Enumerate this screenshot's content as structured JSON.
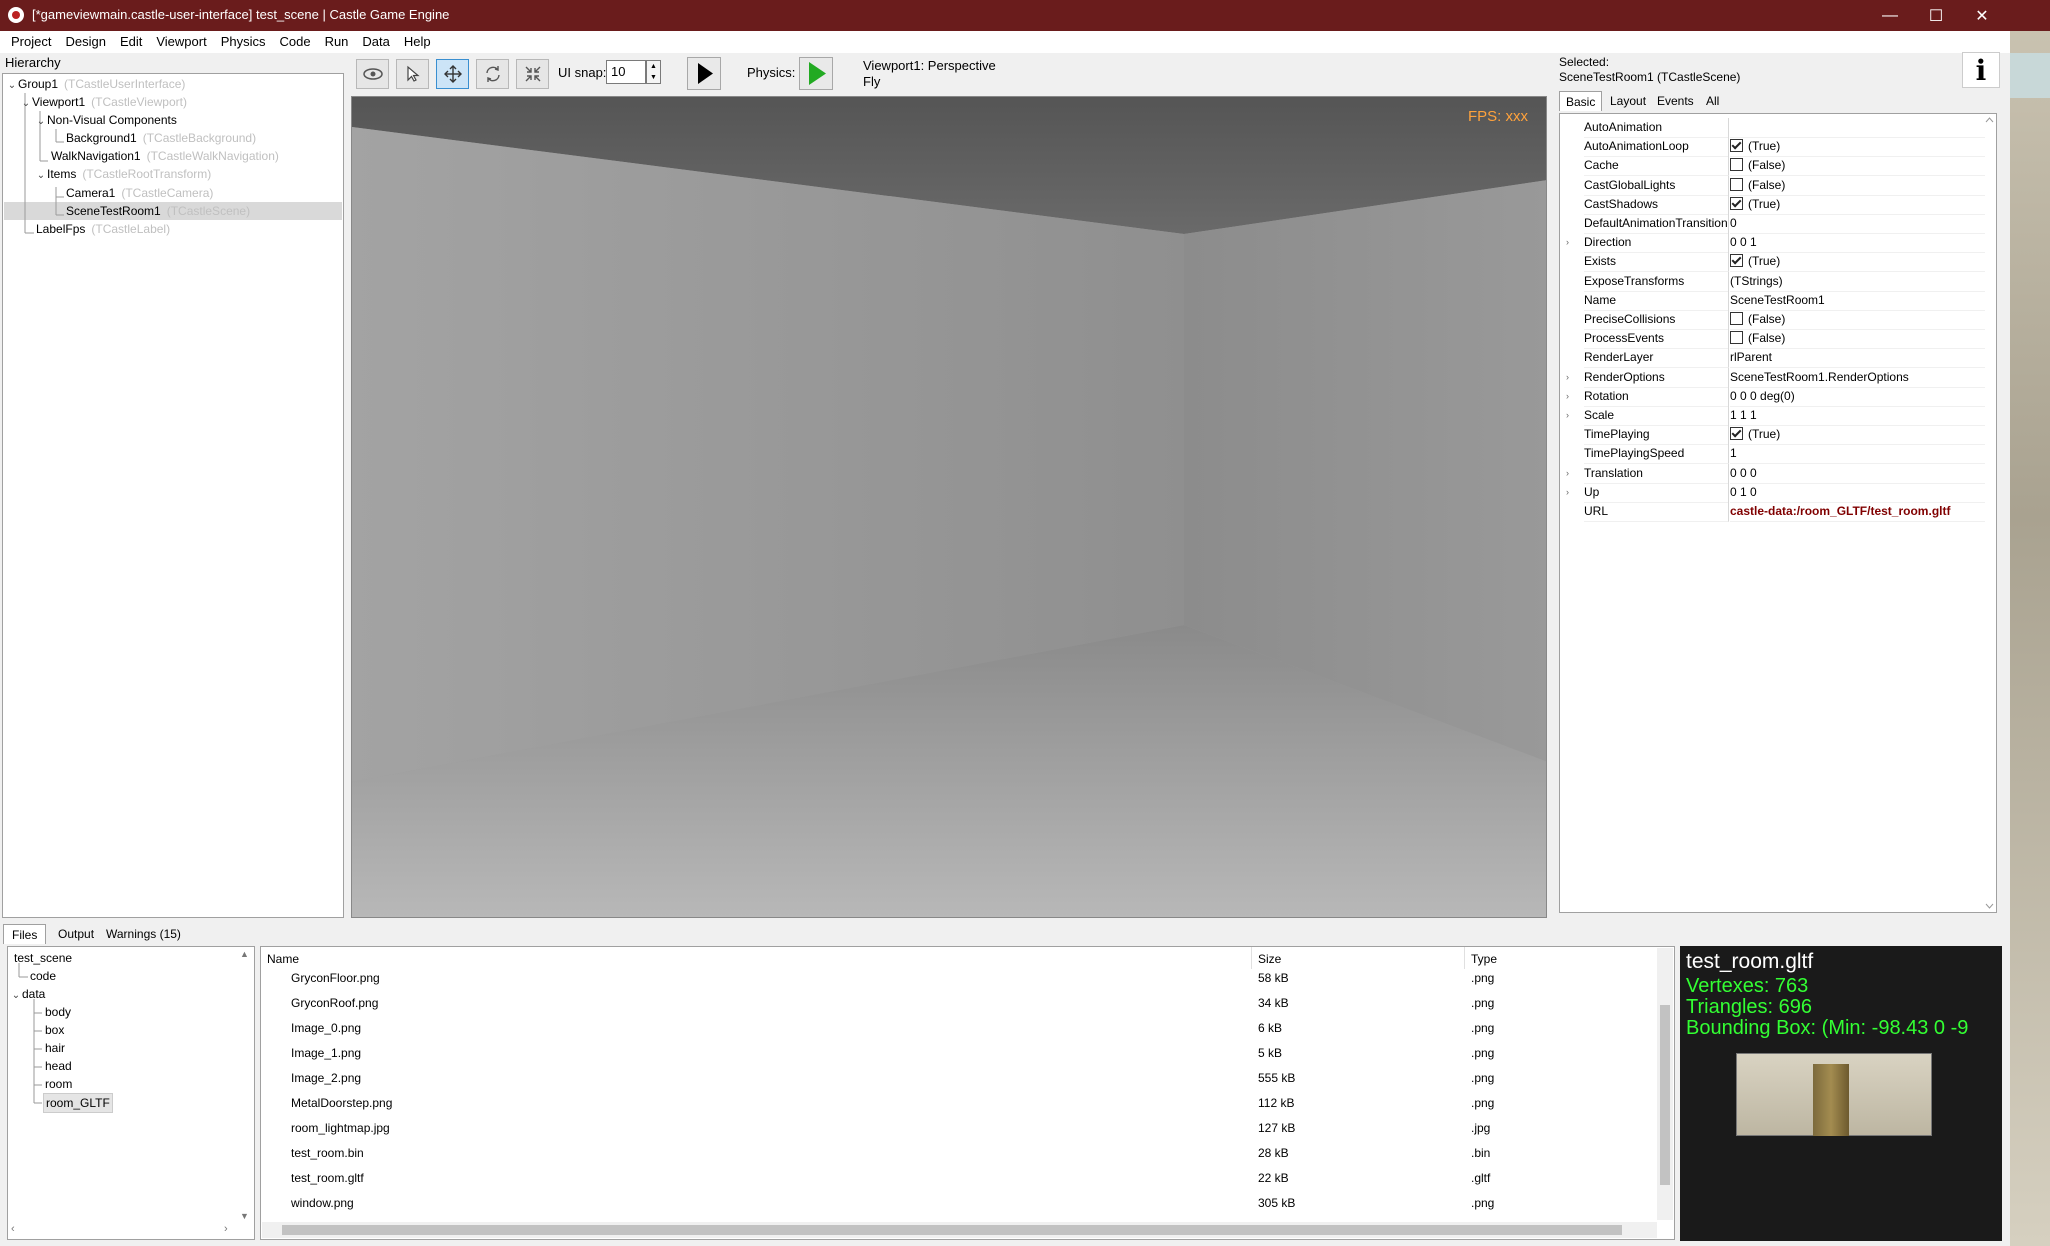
{
  "window": {
    "title": "[*gameviewmain.castle-user-interface] test_scene | Castle Game Engine",
    "controls": {
      "minimize": "—",
      "maximize": "☐",
      "close": "✕"
    }
  },
  "menu": [
    "Project",
    "Design",
    "Edit",
    "Viewport",
    "Physics",
    "Code",
    "Run",
    "Data",
    "Help"
  ],
  "hierarchy": {
    "label": "Hierarchy",
    "items": [
      {
        "name": "Group1",
        "class": "(TCastleUserInterface)"
      },
      {
        "name": "Viewport1",
        "class": "(TCastleViewport)"
      },
      {
        "name": "Non-Visual Components",
        "class": ""
      },
      {
        "name": "Background1",
        "class": "(TCastleBackground)"
      },
      {
        "name": "WalkNavigation1",
        "class": "(TCastleWalkNavigation)"
      },
      {
        "name": "Items",
        "class": "(TCastleRootTransform)"
      },
      {
        "name": "Camera1",
        "class": "(TCastleCamera)"
      },
      {
        "name": "SceneTestRoom1",
        "class": "(TCastleScene)"
      },
      {
        "name": "LabelFps",
        "class": "(TCastleLabel)"
      }
    ]
  },
  "toolbar": {
    "snap_label": "UI snap:",
    "snap_value": "10",
    "physics_label": "Physics:",
    "viewport_info_line1": "Viewport1: Perspective",
    "viewport_info_line2": "Fly"
  },
  "viewport": {
    "fps": "FPS: xxx"
  },
  "inspector": {
    "selected_label": "Selected:",
    "selected_name": "SceneTestRoom1 (TCastleScene)",
    "info_icon": "i",
    "tabs": [
      "Basic",
      "Layout",
      "Events",
      "All"
    ],
    "properties": [
      {
        "name": "AutoAnimation",
        "value": "",
        "check": null,
        "exp": false
      },
      {
        "name": "AutoAnimationLoop",
        "value": "(True)",
        "check": true,
        "exp": false
      },
      {
        "name": "Cache",
        "value": "(False)",
        "check": false,
        "exp": false
      },
      {
        "name": "CastGlobalLights",
        "value": "(False)",
        "check": false,
        "exp": false
      },
      {
        "name": "CastShadows",
        "value": "(True)",
        "check": true,
        "exp": false
      },
      {
        "name": "DefaultAnimationTransition",
        "value": "0",
        "check": null,
        "exp": false
      },
      {
        "name": "Direction",
        "value": "0 0 1",
        "check": null,
        "exp": true
      },
      {
        "name": "Exists",
        "value": "(True)",
        "check": true,
        "exp": false
      },
      {
        "name": "ExposeTransforms",
        "value": "(TStrings)",
        "check": null,
        "exp": false
      },
      {
        "name": "Name",
        "value": "SceneTestRoom1",
        "check": null,
        "exp": false
      },
      {
        "name": "PreciseCollisions",
        "value": "(False)",
        "check": false,
        "exp": false
      },
      {
        "name": "ProcessEvents",
        "value": "(False)",
        "check": false,
        "exp": false
      },
      {
        "name": "RenderLayer",
        "value": "rlParent",
        "check": null,
        "exp": false
      },
      {
        "name": "RenderOptions",
        "value": "SceneTestRoom1.RenderOptions",
        "check": null,
        "exp": true
      },
      {
        "name": "Rotation",
        "value": "0 0 0 deg(0)",
        "check": null,
        "exp": true
      },
      {
        "name": "Scale",
        "value": "1 1 1",
        "check": null,
        "exp": true
      },
      {
        "name": "TimePlaying",
        "value": "(True)",
        "check": true,
        "exp": false
      },
      {
        "name": "TimePlayingSpeed",
        "value": "1",
        "check": null,
        "exp": false
      },
      {
        "name": "Translation",
        "value": "0 0 0",
        "check": null,
        "exp": true
      },
      {
        "name": "Up",
        "value": "0 1 0",
        "check": null,
        "exp": true
      },
      {
        "name": "URL",
        "value": "castle-data:/room_GLTF/test_room.gltf",
        "check": null,
        "exp": false,
        "bold": true
      }
    ]
  },
  "bottom": {
    "tabs": [
      "Files",
      "Output",
      "Warnings (15)"
    ],
    "dirs": [
      "test_scene",
      "code",
      "data",
      "body",
      "box",
      "hair",
      "head",
      "room",
      "room_GLTF"
    ],
    "columns": {
      "name": "Name",
      "size": "Size",
      "type": "Type"
    },
    "files": [
      {
        "name": "GryconFloor.png",
        "size": "58 kB",
        "type": ".png"
      },
      {
        "name": "GryconRoof.png",
        "size": "34 kB",
        "type": ".png"
      },
      {
        "name": "Image_0.png",
        "size": "6 kB",
        "type": ".png"
      },
      {
        "name": "Image_1.png",
        "size": "5 kB",
        "type": ".png"
      },
      {
        "name": "Image_2.png",
        "size": "555 kB",
        "type": ".png"
      },
      {
        "name": "MetalDoorstep.png",
        "size": "112 kB",
        "type": ".png"
      },
      {
        "name": "room_lightmap.jpg",
        "size": "127 kB",
        "type": ".jpg"
      },
      {
        "name": "test_room.bin",
        "size": "28 kB",
        "type": ".bin"
      },
      {
        "name": "test_room.gltf",
        "size": "22 kB",
        "type": ".gltf"
      },
      {
        "name": "window.png",
        "size": "305 kB",
        "type": ".png"
      }
    ]
  },
  "preview": {
    "filename": "test_room.gltf",
    "vertexes": "Vertexes: 763",
    "triangles": "Triangles: 696",
    "bbox": "Bounding Box: (Min: -98.43 0 -9"
  },
  "colors": {
    "titlebar": "#6a1c1c",
    "fps": "#ffa23c",
    "preview_stats": "#33ff33",
    "url_value": "#800000",
    "physics_play": "#22aa22"
  }
}
